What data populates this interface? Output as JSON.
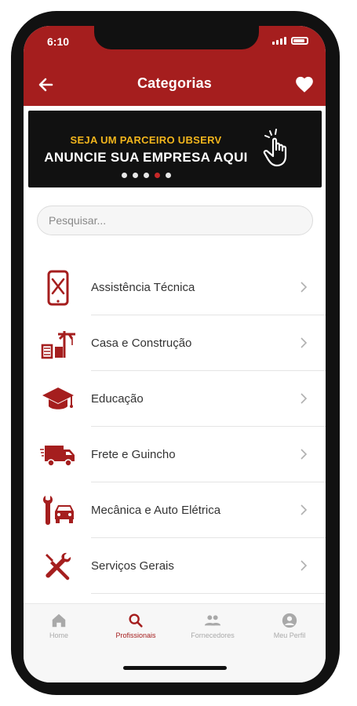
{
  "status": {
    "time": "6:10"
  },
  "header": {
    "title": "Categorias"
  },
  "banner": {
    "line1": "SEJA UM PARCEIRO UBSERV",
    "line2": "ANUNCIE SUA EMPRESA AQUI",
    "dots": 5,
    "active_dot": 3
  },
  "search": {
    "placeholder": "Pesquisar..."
  },
  "categories": [
    {
      "label": "Assistência Técnica",
      "icon": "phone-repair-icon"
    },
    {
      "label": "Casa e Construção",
      "icon": "construction-icon"
    },
    {
      "label": "Educação",
      "icon": "graduation-cap-icon"
    },
    {
      "label": "Frete e Guincho",
      "icon": "delivery-truck-icon"
    },
    {
      "label": "Mecânica e Auto Elétrica",
      "icon": "car-repair-icon"
    },
    {
      "label": "Serviços Gerais",
      "icon": "tools-icon"
    }
  ],
  "nav": [
    {
      "label": "Home",
      "icon": "home-icon"
    },
    {
      "label": "Profissionais",
      "icon": "search-icon"
    },
    {
      "label": "Fornecedores",
      "icon": "people-icon"
    },
    {
      "label": "Meu Perfil",
      "icon": "profile-icon"
    }
  ],
  "colors": {
    "accent": "#a51e1e",
    "banner_yellow": "#f2b51c",
    "banner_bg": "#111111"
  }
}
